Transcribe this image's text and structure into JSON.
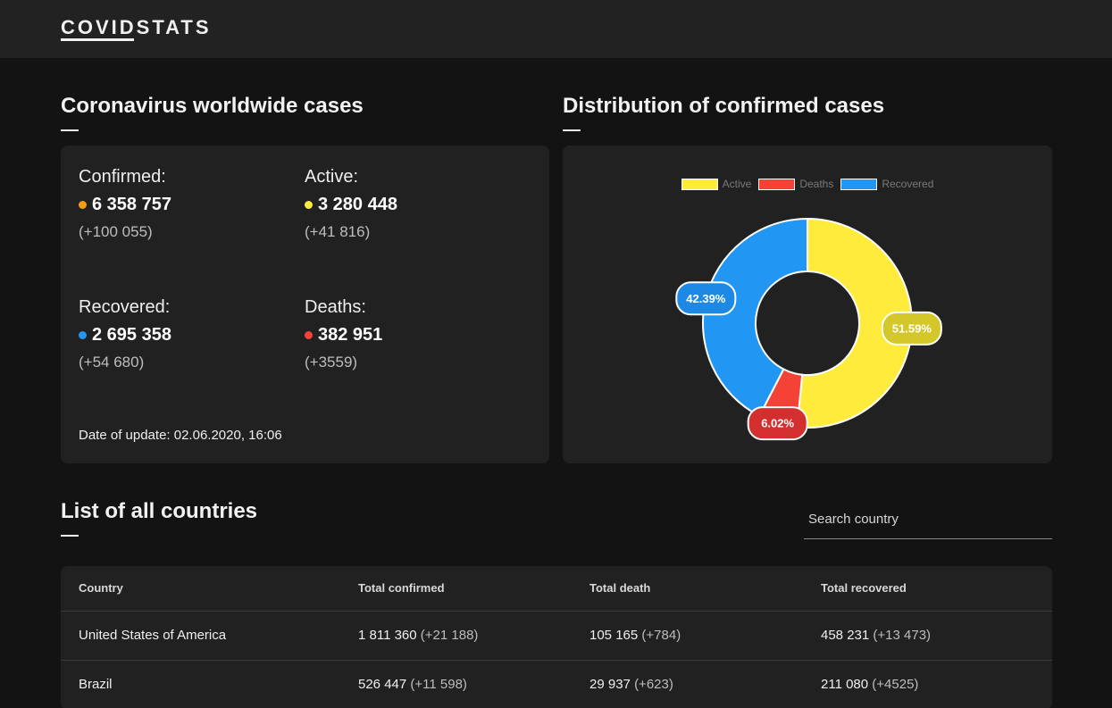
{
  "header": {
    "logo": "COVIDSTATS"
  },
  "worldwide": {
    "title": "Coronavirus worldwide cases",
    "confirmed": {
      "label": "Confirmed:",
      "value": "6 358 757",
      "delta": "(+100 055)",
      "color": "#f39c12"
    },
    "active": {
      "label": "Active:",
      "value": "3 280 448",
      "delta": "(+41 816)",
      "color": "#ffeb3b"
    },
    "recovered": {
      "label": "Recovered:",
      "value": "2 695 358",
      "delta": "(+54 680)",
      "color": "#2196f3"
    },
    "deaths": {
      "label": "Deaths:",
      "value": "382 951",
      "delta": "(+3559)",
      "color": "#f44336"
    },
    "update": "Date of update: 02.06.2020, 16:06"
  },
  "distribution": {
    "title": "Distribution of confirmed cases",
    "legend": [
      {
        "label": "Active",
        "color": "#ffeb3b"
      },
      {
        "label": "Deaths",
        "color": "#f44336"
      },
      {
        "label": "Recovered",
        "color": "#2196f3"
      }
    ]
  },
  "chart_data": {
    "type": "pie",
    "donut": true,
    "categories": [
      "Active",
      "Deaths",
      "Recovered"
    ],
    "values": [
      51.59,
      6.02,
      42.39
    ],
    "labels": [
      "51.59%",
      "6.02%",
      "42.39%"
    ],
    "colors": [
      "#ffeb3b",
      "#f44336",
      "#2196f3"
    ],
    "legend_position": "top"
  },
  "countries": {
    "title": "List of all countries",
    "search_placeholder": "Search country",
    "columns": [
      "Country",
      "Total confirmed",
      "Total death",
      "Total recovered"
    ],
    "rows": [
      {
        "country": "United States of America",
        "confirmed": "1 811 360",
        "confirmed_delta": "(+21 188)",
        "death": "105 165",
        "death_delta": "(+784)",
        "recovered": "458 231",
        "recovered_delta": "(+13 473)"
      },
      {
        "country": "Brazil",
        "confirmed": "526 447",
        "confirmed_delta": "(+11 598)",
        "death": "29 937",
        "death_delta": "(+623)",
        "recovered": "211 080",
        "recovered_delta": "(+4525)"
      }
    ]
  }
}
